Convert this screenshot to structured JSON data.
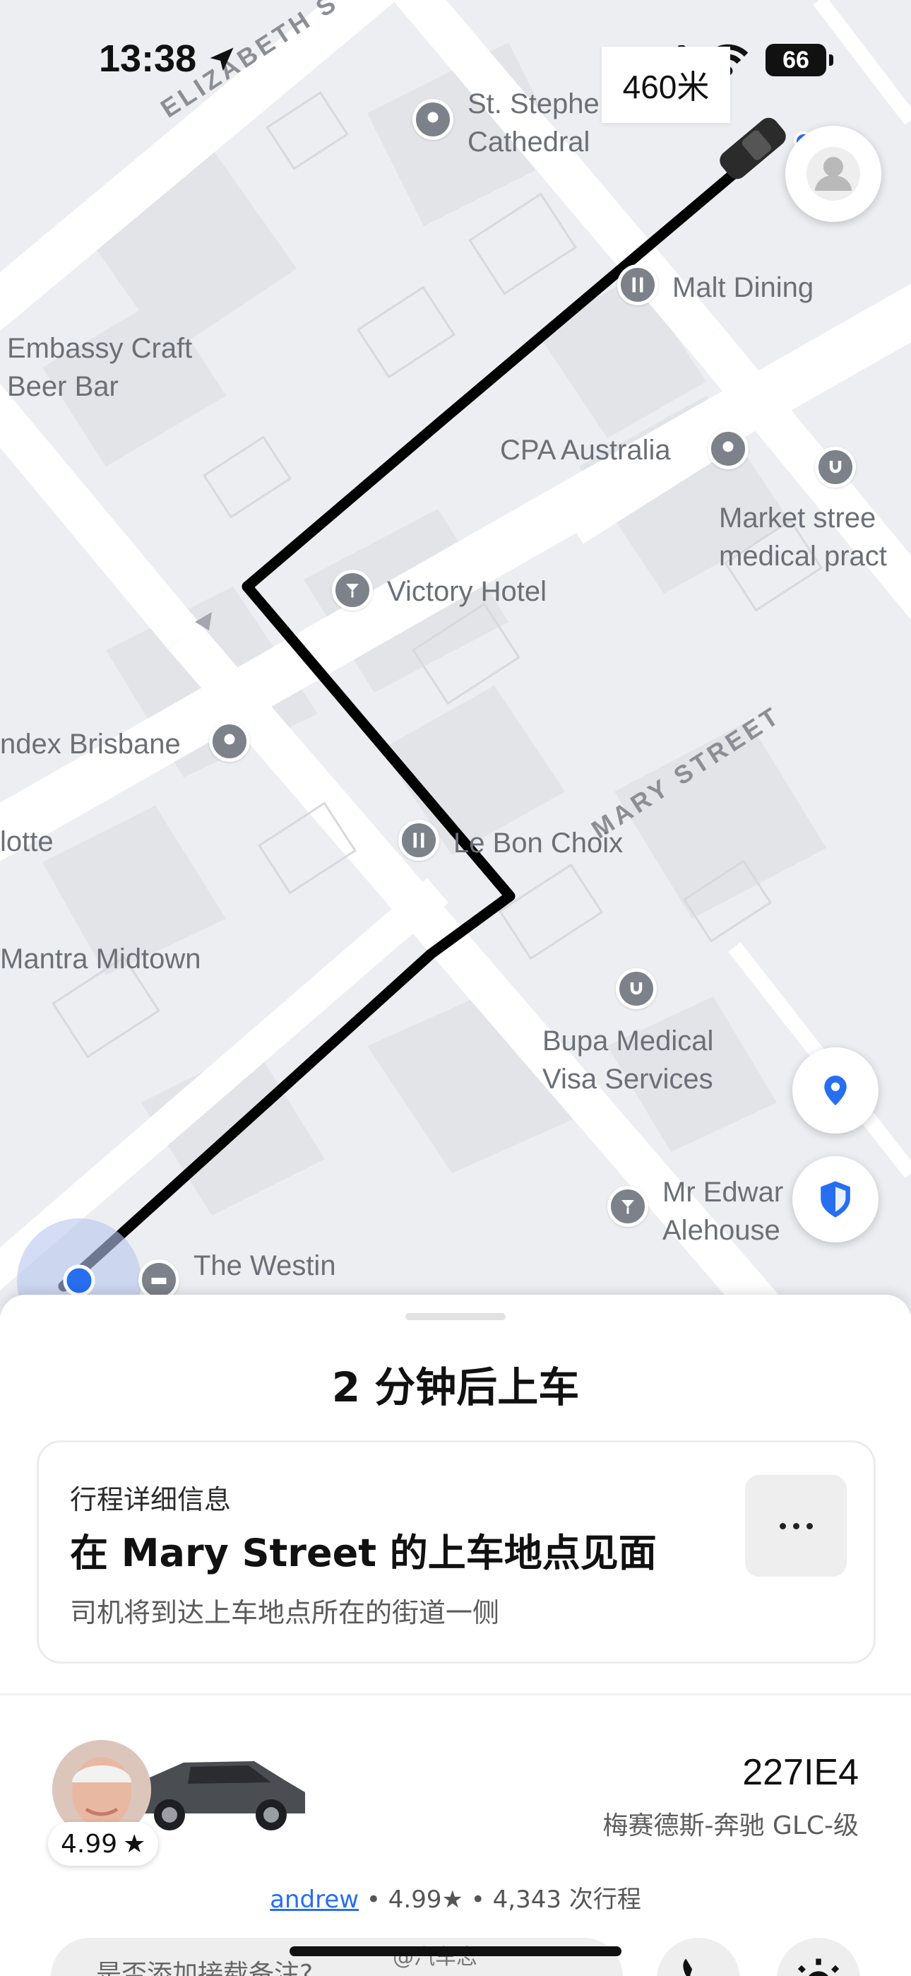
{
  "status_bar": {
    "time": "13:38",
    "battery": "66"
  },
  "navigation": {
    "distance": "460米"
  },
  "map": {
    "streets": [
      "ELIZABETH S",
      "MARY STREET"
    ],
    "places": [
      {
        "name": "St. Stephe\nCathedral",
        "icon": "pin-icon"
      },
      {
        "name": "Malt Dining",
        "icon": "restaurant-icon"
      },
      {
        "name": "Embassy Craft\nBeer Bar",
        "icon": "none"
      },
      {
        "name": "CPA Australia",
        "icon": "pin-icon"
      },
      {
        "name": "Market stree\nmedical pract",
        "icon": "medical-icon"
      },
      {
        "name": "Victory Hotel",
        "icon": "bar-icon"
      },
      {
        "name": "ndex Brisbane",
        "icon": "pin-icon"
      },
      {
        "name": "lotte",
        "icon": "none"
      },
      {
        "name": "Le Bon Choix",
        "icon": "restaurant-icon"
      },
      {
        "name": "Mantra Midtown",
        "icon": "none"
      },
      {
        "name": "Bupa Medical\nVisa Services",
        "icon": "medical-icon"
      },
      {
        "name": "Mr Edwar\nAlehouse",
        "icon": "bar-icon"
      },
      {
        "name": "The Westin",
        "icon": "hotel-icon"
      }
    ]
  },
  "sheet": {
    "title": "2 分钟后上车",
    "trip": {
      "subtitle": "行程详细信息",
      "headline": "在 Mary Street 的上车地点见面",
      "note": "司机将到达上车地点所在的街道一侧"
    },
    "driver": {
      "rating": "4.99",
      "plate": "227IE4",
      "car_model": "梅赛德斯-奔驰 GLC-级",
      "name": "andrew",
      "summary_rating": "4.99★",
      "trips": "4,343 次行程"
    },
    "note_placeholder": "是否添加接载备注?"
  },
  "watermark": "@汽车志",
  "colors": {
    "route": "#000000",
    "map_background": "#eceef1",
    "blue_dot": "#276ef1",
    "link": "#276ef1"
  }
}
